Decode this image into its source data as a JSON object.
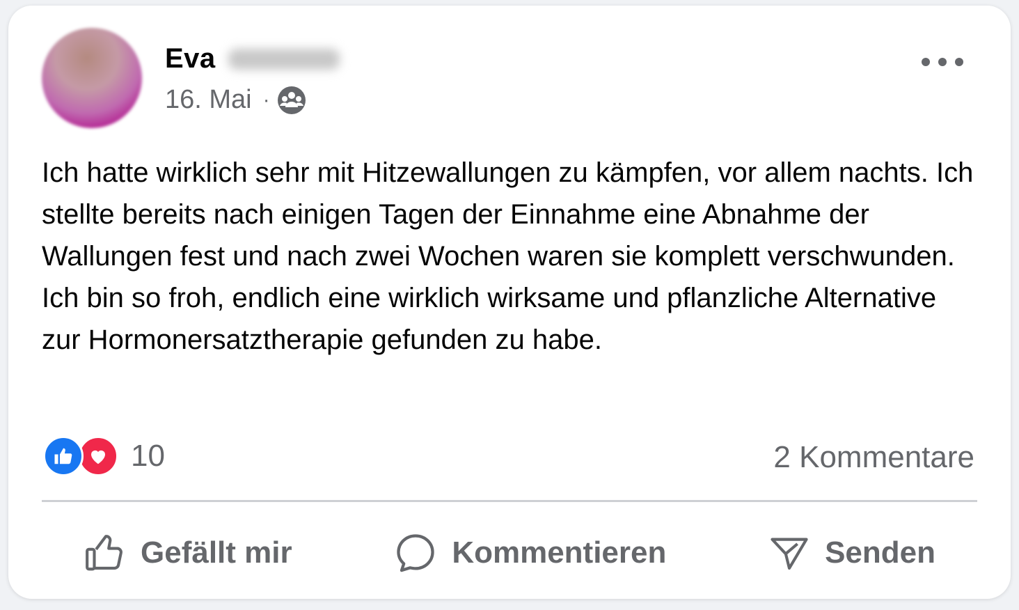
{
  "post": {
    "author": {
      "first_name": "Eva"
    },
    "date": "16. Mai",
    "separator": "·",
    "audience_icon": "group-icon",
    "more_icon": "more-options-icon",
    "text": "Ich hatte wirklich sehr mit Hitzewallungen zu kämpfen, vor allem nachts. Ich stellte bereits nach einigen Tagen der Einnahme eine Abnahme der Wallungen fest und nach zwei Wochen waren sie komplett verschwunden. Ich bin so froh, endlich eine wirklich wirksame und pflanzliche Alternative zur Hormonersatztherapie gefunden zu habe.",
    "reactions": {
      "types": [
        "like",
        "love"
      ],
      "count": "10",
      "like_color": "#1877f2",
      "love_color": "#f0284a"
    },
    "comments_label": "2 Kommentare"
  },
  "actions": [
    {
      "label": "Gefällt mir",
      "icon": "thumbs-up-icon"
    },
    {
      "label": "Kommentieren",
      "icon": "comment-bubble-icon"
    },
    {
      "label": "Senden",
      "icon": "send-icon"
    }
  ],
  "colors": {
    "text_primary": "#050505",
    "text_secondary": "#65676b",
    "divider": "#ced0d4"
  }
}
